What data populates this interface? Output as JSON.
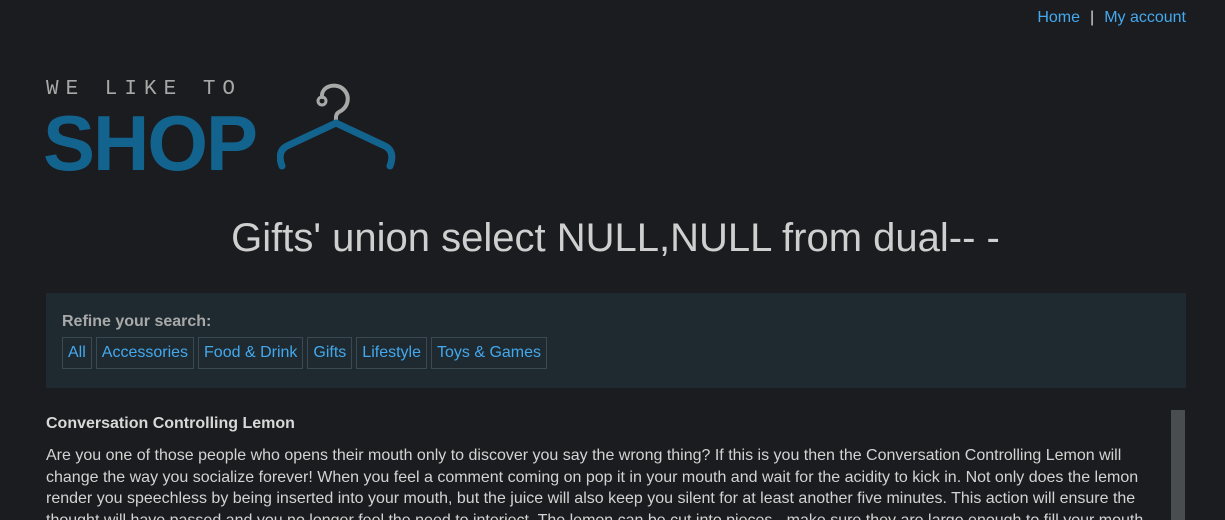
{
  "nav": {
    "home": "Home",
    "separator": "|",
    "account": "My account"
  },
  "logo": {
    "top_text": "WE LIKE TO",
    "main_text": "SHOP",
    "icon": "hanger-icon"
  },
  "search": {
    "title": "Gifts' union select NULL,NULL from dual-- -"
  },
  "filters": {
    "label": "Refine your search:",
    "items": [
      "All",
      "Accessories",
      "Food & Drink",
      "Gifts",
      "Lifestyle",
      "Toys & Games"
    ]
  },
  "product": {
    "name": "Conversation Controlling Lemon",
    "description": "Are you one of those people who opens their mouth only to discover you say the wrong thing? If this is you then the Conversation Controlling Lemon will change the way you socialize forever! When you feel a comment coming on pop it in your mouth and wait for the acidity to kick in. Not only does the lemon render you speechless by being inserted into your mouth, but the juice will also keep you silent for at least another five minutes. This action will ensure the thought will have passed and you no longer feel the need to interject. The lemon can be cut into pieces - make sure they are large enough to fill your mouth"
  },
  "colors": {
    "background": "#1b1c1f",
    "link": "#44a8ee",
    "logo_blue": "#12648f",
    "filter_panel": "#1e2a30"
  }
}
